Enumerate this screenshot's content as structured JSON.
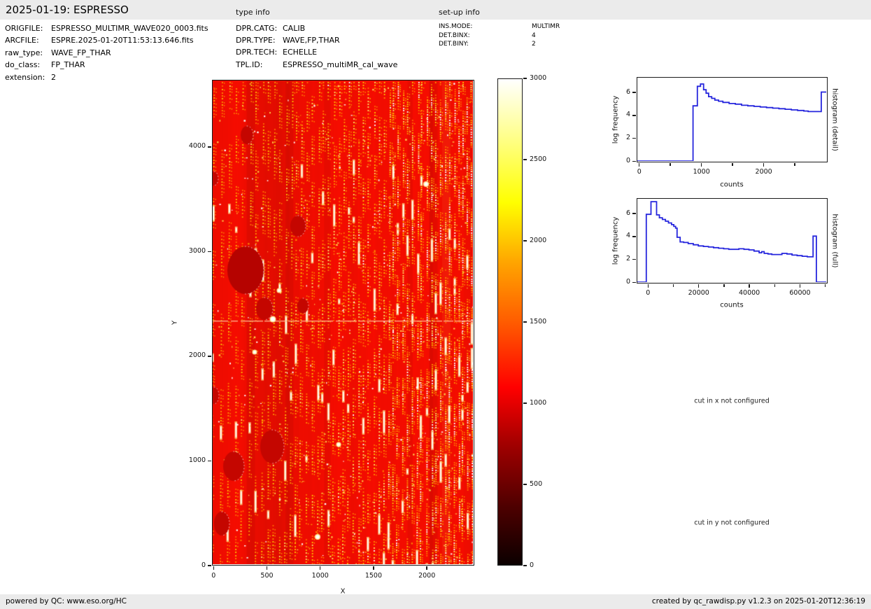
{
  "header": {
    "title": "2025-01-19: ESPRESSO",
    "type_info_label": "type info",
    "setup_info_label": "set-up info"
  },
  "file_info": {
    "rows": [
      {
        "label": "ORIGFILE:",
        "value": "ESPRESSO_MULTIMR_WAVE020_0003.fits"
      },
      {
        "label": "ARCFILE:",
        "value": "ESPRE.2025-01-20T11:53:13.646.fits"
      },
      {
        "label": "raw_type:",
        "value": "WAVE_FP_THAR"
      },
      {
        "label": "do_class:",
        "value": "FP_THAR"
      },
      {
        "label": "extension:",
        "value": "2"
      }
    ]
  },
  "type_info": {
    "rows": [
      {
        "label": "DPR.CATG:",
        "value": "CALIB"
      },
      {
        "label": "DPR.TYPE:",
        "value": "WAVE,FP,THAR"
      },
      {
        "label": "DPR.TECH:",
        "value": "ECHELLE"
      },
      {
        "label": "TPL.ID:",
        "value": "ESPRESSO_multiMR_cal_wave"
      }
    ]
  },
  "setup_info": {
    "rows": [
      {
        "label": "INS.MODE:",
        "value": "MULTIMR"
      },
      {
        "label": "DET.BINX:",
        "value": "4"
      },
      {
        "label": "DET.BINY:",
        "value": "2"
      }
    ]
  },
  "messages": {
    "cut_x": "cut in x not configured",
    "cut_y": "cut in y not configured"
  },
  "footer": {
    "left": "powered by QC: www.eso.org/HC",
    "right": "created by qc_rawdisp.py v1.2.3 on 2025-01-20T12:36:19"
  },
  "colors": {
    "line_blue": "#2626dd",
    "header_bg": "#ebebeb",
    "image_red": "#ee0e00",
    "axis_black": "#1a1a1a"
  },
  "chart_data": [
    {
      "type": "heatmap",
      "name": "raw detector image",
      "xlabel": "X",
      "ylabel": "Y",
      "xlim": [
        -15,
        2445
      ],
      "ylim": [
        0,
        4642
      ],
      "xticks": [
        0,
        500,
        1000,
        1500,
        2000
      ],
      "yticks": [
        0,
        1000,
        2000,
        3000,
        4000
      ],
      "colormap": "hot",
      "description": "raw echelle FP/ThAr frame: red background with ~50 dotted vertical emission stripes, dark low-sensitivity blobs, horizontal seam near Y=2350",
      "colorbar": {
        "vmin": 0,
        "vmax": 3000,
        "ticks": [
          0,
          500,
          1000,
          1500,
          2000,
          2500,
          3000
        ],
        "stops": [
          [
            0,
            "#0b0000"
          ],
          [
            0.12,
            "#4e0000"
          ],
          [
            0.25,
            "#a30000"
          ],
          [
            0.365,
            "#ff0000"
          ],
          [
            0.5,
            "#ff5c00"
          ],
          [
            0.62,
            "#ffa300"
          ],
          [
            0.746,
            "#ffff00"
          ],
          [
            0.87,
            "#ffff80"
          ],
          [
            1,
            "#ffffff"
          ]
        ]
      }
    },
    {
      "type": "line",
      "name": "histogram (detail)",
      "xlabel": "counts",
      "ylabel": "log frequency",
      "right_label": "histogram (detail)",
      "xlim": [
        -25,
        3010
      ],
      "ylim": [
        0,
        7.25
      ],
      "xticks": [
        0,
        1000,
        2000
      ],
      "xticks_minor": [
        500,
        1500,
        2500
      ],
      "yticks": [
        0,
        2,
        4,
        6
      ],
      "steps": [
        [
          -25,
          0
        ],
        [
          870,
          4.8
        ],
        [
          940,
          6.5
        ],
        [
          990,
          6.7
        ],
        [
          1040,
          6.2
        ],
        [
          1080,
          5.9
        ],
        [
          1120,
          5.6
        ],
        [
          1170,
          5.45
        ],
        [
          1220,
          5.3
        ],
        [
          1280,
          5.2
        ],
        [
          1350,
          5.1
        ],
        [
          1450,
          5.0
        ],
        [
          1550,
          4.95
        ],
        [
          1650,
          4.85
        ],
        [
          1750,
          4.8
        ],
        [
          1850,
          4.75
        ],
        [
          1950,
          4.7
        ],
        [
          2050,
          4.65
        ],
        [
          2150,
          4.6
        ],
        [
          2250,
          4.55
        ],
        [
          2350,
          4.5
        ],
        [
          2450,
          4.45
        ],
        [
          2550,
          4.4
        ],
        [
          2650,
          4.35
        ],
        [
          2720,
          4.3
        ],
        [
          2930,
          6.0
        ],
        [
          3010,
          6.0
        ]
      ]
    },
    {
      "type": "line",
      "name": "histogram (full)",
      "xlabel": "counts",
      "ylabel": "log frequency",
      "right_label": "histogram (full)",
      "xlim": [
        -4100,
        70500
      ],
      "ylim": [
        0,
        7.25
      ],
      "xticks": [
        0,
        20000,
        40000,
        60000
      ],
      "xticks_minor": [
        10000,
        30000,
        50000,
        70000
      ],
      "yticks": [
        0,
        2,
        4,
        6
      ],
      "steps": [
        [
          -4100,
          0
        ],
        [
          -550,
          5.9
        ],
        [
          1300,
          7.0
        ],
        [
          3500,
          5.85
        ],
        [
          4600,
          5.6
        ],
        [
          5800,
          5.45
        ],
        [
          7000,
          5.3
        ],
        [
          8200,
          5.15
        ],
        [
          9400,
          5.0
        ],
        [
          10300,
          4.85
        ],
        [
          11000,
          4.7
        ],
        [
          11600,
          3.9
        ],
        [
          12800,
          3.5
        ],
        [
          14200,
          3.45
        ],
        [
          16000,
          3.35
        ],
        [
          18000,
          3.25
        ],
        [
          20000,
          3.15
        ],
        [
          22000,
          3.1
        ],
        [
          24000,
          3.05
        ],
        [
          26000,
          3.0
        ],
        [
          28000,
          2.95
        ],
        [
          30000,
          2.9
        ],
        [
          32000,
          2.85
        ],
        [
          34000,
          2.85
        ],
        [
          36000,
          2.9
        ],
        [
          38000,
          2.85
        ],
        [
          40000,
          2.8
        ],
        [
          42000,
          2.7
        ],
        [
          44000,
          2.55
        ],
        [
          45000,
          2.65
        ],
        [
          46000,
          2.5
        ],
        [
          47500,
          2.45
        ],
        [
          49000,
          2.4
        ],
        [
          51000,
          2.4
        ],
        [
          53000,
          2.5
        ],
        [
          55000,
          2.45
        ],
        [
          57000,
          2.35
        ],
        [
          59000,
          2.3
        ],
        [
          61000,
          2.25
        ],
        [
          63000,
          2.2
        ],
        [
          65300,
          4.0
        ],
        [
          66600,
          0
        ],
        [
          70500,
          0
        ]
      ]
    }
  ]
}
